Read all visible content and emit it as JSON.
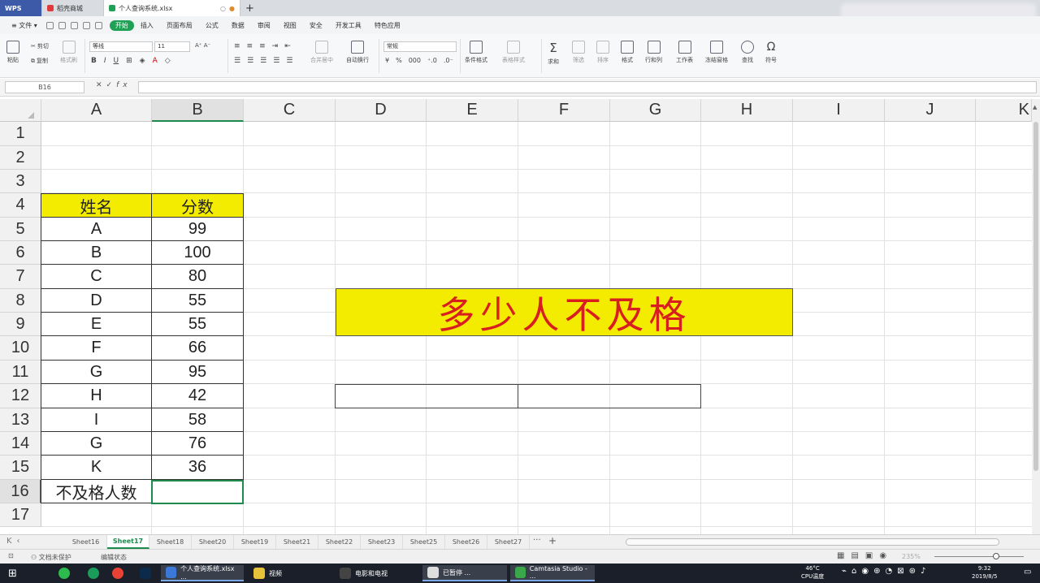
{
  "tabs": {
    "wps": "WPS",
    "mall": "稻壳商城",
    "file": "个人查询系统.xlsx",
    "new_tab": "+"
  },
  "menu": {
    "file": "文件",
    "items": [
      "开始",
      "插入",
      "页面布局",
      "公式",
      "数据",
      "审阅",
      "视图",
      "安全",
      "开发工具",
      "特色应用"
    ],
    "active": "开始"
  },
  "ribbon": {
    "paste": "粘贴",
    "cut": "剪切",
    "copy": "复制",
    "format_painter": "格式刷",
    "font": "等线",
    "font_size": "11",
    "bold": "B",
    "italic": "I",
    "underline": "U",
    "merge": "合并居中",
    "wrap": "自动换行",
    "number_format": "常规",
    "cond_format": "条件格式",
    "table_style": "表格样式",
    "sum": "求和",
    "filter": "筛选",
    "sort": "排序",
    "format": "格式",
    "row_col": "行和列",
    "worksheet": "工作表",
    "freeze": "冻结窗格",
    "find": "查找",
    "symbol": "符号"
  },
  "formula_bar": {
    "cell_ref": "B16",
    "fx": "fx",
    "cancel": "✕",
    "confirm": "✓",
    "formula": ""
  },
  "columns": [
    "A",
    "B",
    "C",
    "D",
    "E",
    "F",
    "G",
    "H",
    "I",
    "J",
    "K"
  ],
  "rows": [
    "1",
    "2",
    "3",
    "4",
    "5",
    "6",
    "7",
    "8",
    "9",
    "10",
    "11",
    "12",
    "13",
    "14",
    "15",
    "16",
    "17"
  ],
  "table": {
    "header_name": "姓名",
    "header_score": "分数",
    "rows": [
      [
        "A",
        "99"
      ],
      [
        "B",
        "100"
      ],
      [
        "C",
        "80"
      ],
      [
        "D",
        "55"
      ],
      [
        "E",
        "55"
      ],
      [
        "F",
        "66"
      ],
      [
        "G",
        "95"
      ],
      [
        "H",
        "42"
      ],
      [
        "I",
        "58"
      ],
      [
        "G",
        "76"
      ],
      [
        "K",
        "36"
      ]
    ],
    "footer_label": "不及格人数",
    "footer_value": ""
  },
  "banner": "多少人不及格",
  "sheets": [
    "Sheet16",
    "Sheet17",
    "Sheet18",
    "Sheet20",
    "Sheet19",
    "Sheet21",
    "Sheet22",
    "Sheet23",
    "Sheet25",
    "Sheet26",
    "Sheet27"
  ],
  "active_sheet": "Sheet17",
  "status": {
    "protect": "文档未保护",
    "edit_state": "编辑状态",
    "zoom": "235%"
  },
  "taskbar": {
    "apps": [
      "个人查询系统.xlsx ...",
      "视频",
      "电影和电视",
      "已暂停 ...",
      "Camtasia Studio - ..."
    ],
    "temp": "46°C",
    "cpu": "CPU温度",
    "time": "9:32",
    "date": "2019/8/5"
  },
  "colors": {
    "accent": "#1e8a4c",
    "highlight": "#f3ec00",
    "banner_text": "#d81e1e"
  }
}
